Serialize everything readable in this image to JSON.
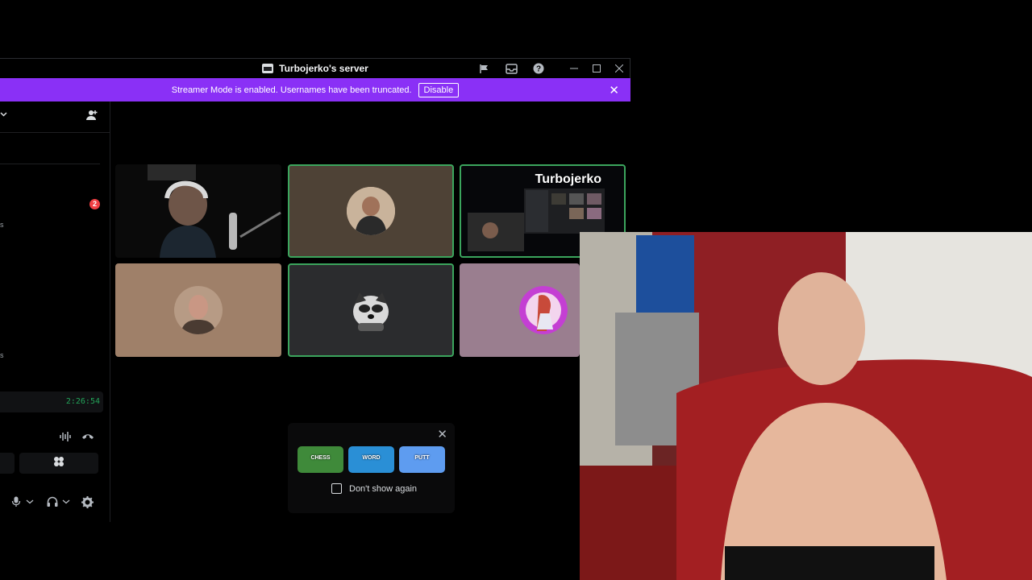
{
  "window": {
    "title": "Turbojerko's server",
    "title_icons": [
      "flag-icon",
      "inbox-icon",
      "help-icon"
    ],
    "controls": [
      "minimize-icon",
      "maximize-icon",
      "close-icon"
    ]
  },
  "banner": {
    "message": "Streamer Mode is enabled. Usernames have been truncated.",
    "disable_label": "Disable",
    "background": "#8a30f6"
  },
  "sidebar": {
    "badge_count": "2",
    "call_timer": "2:26:54",
    "marks": [
      "s",
      "s"
    ]
  },
  "tiles": [
    {
      "kind": "camera",
      "speaking": false
    },
    {
      "kind": "avatar",
      "speaking": true,
      "bg": "#4e4236"
    },
    {
      "kind": "stream",
      "speaking": true,
      "label": "Turbojerko"
    },
    {
      "kind": "avatar",
      "speaking": false,
      "bg": "#9f8069"
    },
    {
      "kind": "avatar",
      "speaking": true,
      "bg": "#2b2c2e"
    },
    {
      "kind": "avatar",
      "speaking": false,
      "bg": "#9a7e8f"
    }
  ],
  "activity_popup": {
    "games": [
      "CHESS",
      "WORD",
      "PUTT"
    ],
    "dont_show_label": "Don't show again"
  },
  "colors": {
    "accent": "#8a30f6",
    "speaking_border": "#3ba55d",
    "badge": "#f23f43",
    "timer": "#23a55a"
  }
}
